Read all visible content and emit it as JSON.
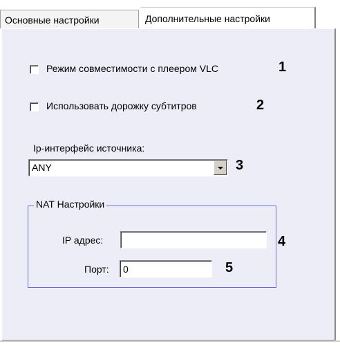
{
  "tabs": [
    {
      "label": "Основные настройки"
    },
    {
      "label": "Дополнительные настройки"
    }
  ],
  "options": {
    "vlc_compat": {
      "label": "Режим совместимости с плеером VLC",
      "checked": false,
      "marker": "1"
    },
    "subtitles": {
      "label": "Использовать дорожку субтитров",
      "checked": false,
      "marker": "2"
    }
  },
  "ip_interface": {
    "label": "Ip-интерфейс источника:",
    "value": "ANY",
    "marker": "3"
  },
  "nat": {
    "title": "NAT Настройки",
    "ip_label": "IP адрес:",
    "ip_value": "",
    "ip_marker": "4",
    "port_label": "Порт:",
    "port_value": "0",
    "port_marker": "5"
  },
  "icons": {
    "dropdown": "chevron-down-icon"
  }
}
